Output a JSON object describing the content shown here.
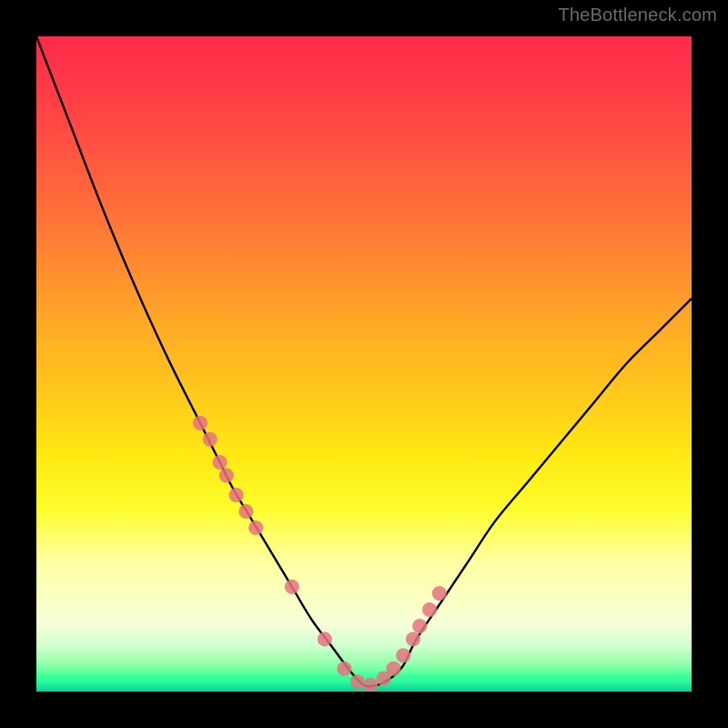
{
  "watermark": "TheBottleneck.com",
  "chart_data": {
    "type": "line",
    "title": "",
    "xlabel": "",
    "ylabel": "",
    "xlim": [
      0,
      100
    ],
    "ylim": [
      0,
      100
    ],
    "series": [
      {
        "name": "bottleneck-curve",
        "x": [
          0,
          5,
          10,
          15,
          20,
          25,
          28,
          30,
          33,
          36,
          39,
          42,
          45,
          48,
          50,
          52,
          54,
          56,
          58,
          62,
          66,
          70,
          75,
          80,
          85,
          90,
          95,
          100
        ],
        "y": [
          100,
          87,
          74,
          62,
          51,
          41,
          35,
          31,
          26,
          21,
          16,
          11,
          7,
          3,
          1,
          1,
          2,
          4,
          8,
          14,
          20,
          26,
          32,
          38,
          44,
          50,
          55,
          60
        ]
      }
    ],
    "markers": {
      "name": "highlight-dots",
      "color": "#e57380",
      "x": [
        25,
        26.5,
        28,
        29,
        30.5,
        32,
        33.5,
        39,
        44,
        47,
        49,
        51,
        53,
        54.5,
        56,
        57.5,
        58.5,
        60,
        61.5
      ],
      "y": [
        41,
        38.5,
        35,
        33,
        30,
        27.5,
        25,
        16,
        8,
        3.5,
        1.5,
        1,
        2,
        3.5,
        5.5,
        8,
        10,
        12.5,
        15
      ]
    },
    "gradient_stops": [
      {
        "pos": 0,
        "color": "#ff2b4a"
      },
      {
        "pos": 36,
        "color": "#ff7a36"
      },
      {
        "pos": 64,
        "color": "#ffe913"
      },
      {
        "pos": 86,
        "color": "#fcffc4"
      },
      {
        "pos": 100,
        "color": "#00e59a"
      }
    ]
  }
}
